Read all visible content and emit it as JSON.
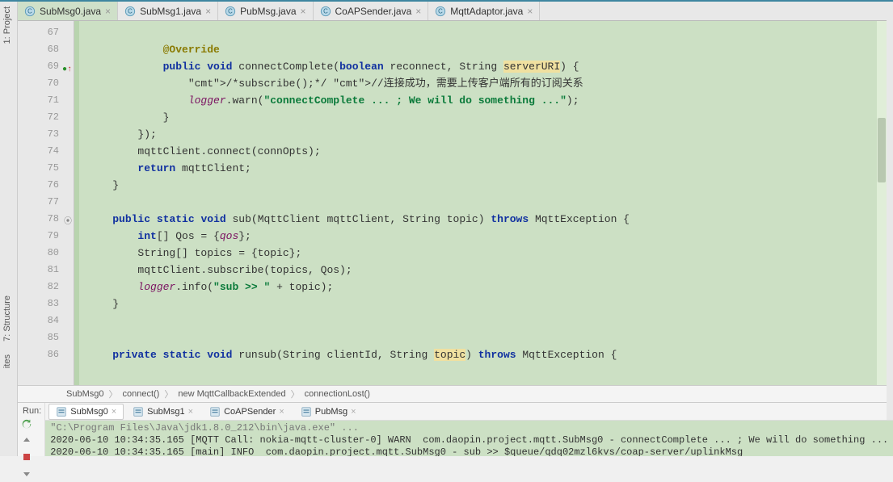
{
  "sidebar": {
    "project": "1: Project",
    "structure": "7: Structure",
    "favorites": "ites"
  },
  "tabs": [
    {
      "name": "SubMsg0.java",
      "active": true
    },
    {
      "name": "SubMsg1.java",
      "active": false
    },
    {
      "name": "PubMsg.java",
      "active": false
    },
    {
      "name": "CoAPSender.java",
      "active": false
    },
    {
      "name": "MqttAdaptor.java",
      "active": false
    }
  ],
  "gutter": {
    "start": 67,
    "end": 86,
    "marks": {
      "69": "green-up-red",
      "78": "gray"
    }
  },
  "code": {
    "lines": [
      "",
      "            @Override",
      "            public void connectComplete(boolean reconnect, String serverURI) {",
      "                /*subscribe();*/ //连接成功，需要上传客户端所有的订阅关系",
      "                logger.warn(\"connectComplete ... ; We will do something ...\");",
      "            }",
      "        });",
      "        mqttClient.connect(connOpts);",
      "        return mqttClient;",
      "    }",
      "",
      "    public static void sub(MqttClient mqttClient, String topic) throws MqttException {",
      "        int[] Qos = {qos};",
      "        String[] topics = {topic};",
      "        mqttClient.subscribe(topics, Qos);",
      "        logger.info(\"sub >> \" + topic);",
      "    }",
      "",
      "",
      "    private static void runsub(String clientId, String topic) throws MqttException {"
    ]
  },
  "breadcrumb": [
    "SubMsg0",
    "connect()",
    "new MqttCallbackExtended",
    "connectionLost()"
  ],
  "run": {
    "label": "Run:",
    "tabs": [
      {
        "name": "SubMsg0",
        "active": true
      },
      {
        "name": "SubMsg1",
        "active": false
      },
      {
        "name": "CoAPSender",
        "active": false
      },
      {
        "name": "PubMsg",
        "active": false
      }
    ],
    "console": [
      "\"C:\\Program Files\\Java\\jdk1.8.0_212\\bin\\java.exe\" ...",
      "2020-06-10 10:34:35.165 [MQTT Call: nokia-mqtt-cluster-0] WARN  com.daopin.project.mqtt.SubMsg0 - connectComplete ... ; We will do something ...",
      "2020-06-10 10:34:35.165 [main] INFO  com.daopin.project.mqtt.SubMsg0 - sub >> $queue/qdq02mzl6kvs/coap-server/uplinkMsg"
    ]
  }
}
